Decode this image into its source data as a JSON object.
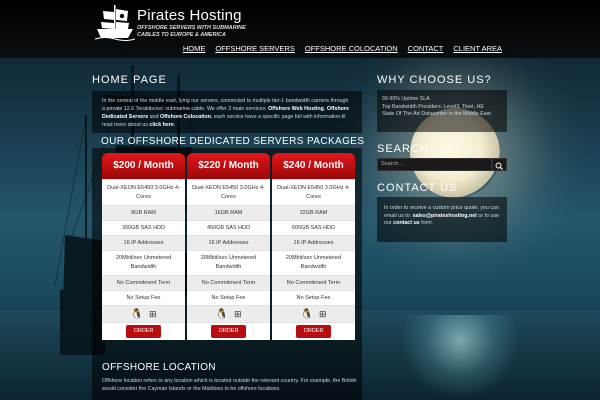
{
  "brand": {
    "title": "Pirates Hosting",
    "subtitle": "Offshore servers with submarine cables to Europe & America"
  },
  "nav": [
    "HOME",
    "OFFSHORE SERVERS",
    "OFFSHORE COLOCATION",
    "CONTACT",
    "CLIENT AREA"
  ],
  "home": {
    "heading": "HOME PAGE",
    "text_1": "In the central of the middle east, lying our servers, connected to multiple tier-1 bandwidth carriers through a private 12.6 Terabits/sec submarine cable. We offer 3 main services:",
    "link_web": "Offshore Web Hosting",
    "sep_1": ", ",
    "link_dedicated": "Offshore Dedicated Servers",
    "sep_2": " and ",
    "link_colo": "Offshore Colocation",
    "text_2": ", each service have a specific page full with information-lil read more about us",
    "link_click": "click here"
  },
  "packages": {
    "heading": "OUR OFFSHORE DEDICATED SERVERS PACKAGES",
    "plans": [
      {
        "price": "$200 / Month",
        "cpu": "Dual-XEON E5450 3.0GHz 4-Cores",
        "ram": "8GB RAM",
        "disk": "300GB SAS HDD",
        "ips": "16 IP Addresses",
        "bandwidth": "20Mbit/sec Unmetered Bandwidth",
        "term": "No Commitment Term",
        "setup": "No Setup Fee",
        "order": "ORDER"
      },
      {
        "price": "$220 / Month",
        "cpu": "Dual-XEON E5450 3.0GHz 4-Cores",
        "ram": "16GB RAM",
        "disk": "450GB SAS HDD",
        "ips": "16 IP Addresses",
        "bandwidth": "20Mbit/sec Unmetered Bandwidth",
        "term": "No Commitment Term",
        "setup": "No Setup Fee",
        "order": "ORDER"
      },
      {
        "price": "$240 / Month",
        "cpu": "Dual-XEON E5450 3.0GHz 4-Cores",
        "ram": "32GB RAM",
        "disk": "600GB SAS HDD",
        "ips": "16 IP Addresses",
        "bandwidth": "20Mbit/sec Unmetered Bandwidth",
        "term": "No Commitment Term",
        "setup": "No Setup Fee",
        "order": "ORDER"
      }
    ]
  },
  "location": {
    "heading": "OFFSHORE LOCATION",
    "text": "Offshore location refers to any location which is located outside the relevant country. For example, the British would consider the Cayman Islands or the Maldives to be offshore locations."
  },
  "why": {
    "heading": "WHY CHOOSE US?",
    "line_1": "99.99% Uptime SLA",
    "line_2": "Top Bandwidth Providers: Level3, Tinet, HE",
    "line_3": "State Of The Art Datacenter in the Middle East"
  },
  "search": {
    "heading": "SEARCH",
    "placeholder": "Search..."
  },
  "contact": {
    "heading": "CONTACT US",
    "text_1": "In order to receive a custom price quote, you can email us to:",
    "email": "sales@pirateshosting.net",
    "text_2": " or to use our ",
    "link": "contact us",
    "text_3": " form."
  }
}
